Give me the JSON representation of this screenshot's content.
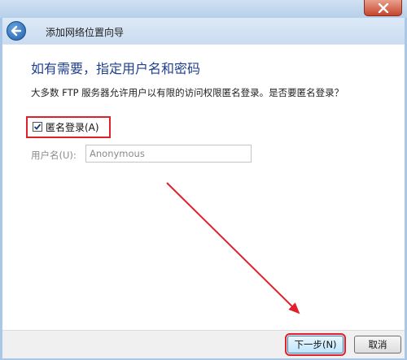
{
  "window": {
    "title": "添加网络位置向导"
  },
  "page": {
    "heading": "如有需要，指定用户名和密码",
    "description": "大多数 FTP 服务器允许用户以有限的访问权限匿名登录。是否要匿名登录？"
  },
  "anonymous": {
    "label": "匿名登录(A)",
    "checked": true
  },
  "username": {
    "label": "用户名(U):",
    "value": "Anonymous"
  },
  "buttons": {
    "next": "下一步(N)",
    "cancel": "取消"
  },
  "annotation_color": "#e0202a"
}
